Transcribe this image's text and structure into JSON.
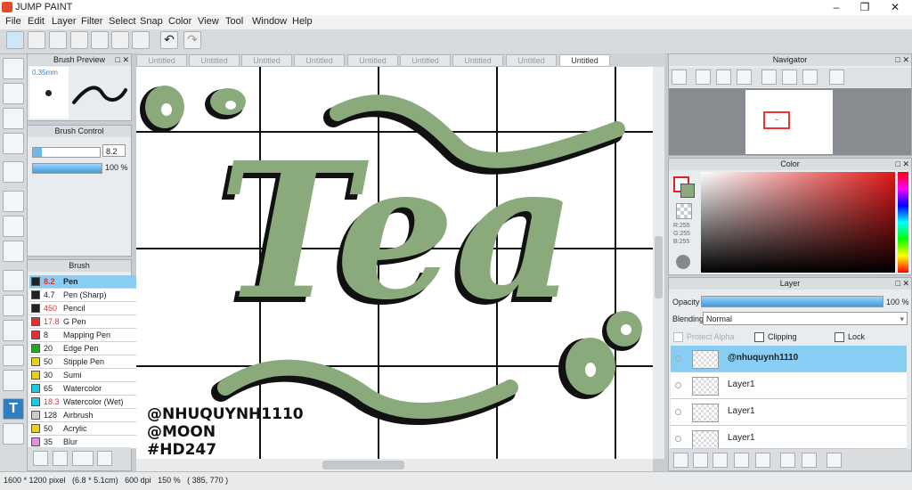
{
  "window": {
    "title": "JUMP PAINT"
  },
  "menu": [
    "File",
    "Edit",
    "Layer",
    "Filter",
    "Select",
    "Snap",
    "Color",
    "View",
    "Tool",
    "Window",
    "Help"
  ],
  "tabs": [
    "Untitled",
    "Untitled",
    "Untitled",
    "Untitled",
    "Untitled",
    "Untitled",
    "Untitled",
    "Untitled",
    "Untitled"
  ],
  "brush_preview": {
    "title": "Brush Preview",
    "size": "0.35mm"
  },
  "brush_control": {
    "title": "Brush Control",
    "size_value": "8.2",
    "opacity_value": "100 %"
  },
  "brush": {
    "title": "Brush",
    "items": [
      {
        "size": "8.2",
        "name": "Pen",
        "color": "#222222",
        "size_color": "#d33"
      },
      {
        "size": "4.7",
        "name": "Pen (Sharp)",
        "color": "#222222",
        "size_color": "#222"
      },
      {
        "size": "450",
        "name": "Pencil",
        "color": "#222222",
        "size_color": "#d33"
      },
      {
        "size": "17.8",
        "name": "G Pen",
        "color": "#e03030",
        "size_color": "#d33"
      },
      {
        "size": "8",
        "name": "Mapping Pen",
        "color": "#e03030",
        "size_color": "#222"
      },
      {
        "size": "20",
        "name": "Edge Pen",
        "color": "#22aa22",
        "size_color": "#222"
      },
      {
        "size": "50",
        "name": "Stipple Pen",
        "color": "#e8d020",
        "size_color": "#222"
      },
      {
        "size": "30",
        "name": "Sumi",
        "color": "#e8d020",
        "size_color": "#222"
      },
      {
        "size": "65",
        "name": "Watercolor",
        "color": "#1ec8e0",
        "size_color": "#222"
      },
      {
        "size": "18.3",
        "name": "Watercolor (Wet)",
        "color": "#1ec8e0",
        "size_color": "#d33"
      },
      {
        "size": "128",
        "name": "Airbrush",
        "color": "#cccccc",
        "size_color": "#222"
      },
      {
        "size": "50",
        "name": "Acrylic",
        "color": "#e8d020",
        "size_color": "#222"
      },
      {
        "size": "35",
        "name": "Blur",
        "color": "#e090e0",
        "size_color": "#222"
      }
    ]
  },
  "navigator": {
    "title": "Navigator"
  },
  "color": {
    "title": "Color",
    "r": "R:255",
    "g": "G:255",
    "b": "B:255"
  },
  "layer": {
    "title": "Layer",
    "opacity_label": "Opacity",
    "opacity_value": "100 %",
    "blending_label": "Blending",
    "blending_value": "Normal",
    "protect_alpha": "Protect Alpha",
    "clipping": "Clipping",
    "lock": "Lock",
    "items": [
      "@nhuquynh1110",
      "Layer1",
      "Layer1",
      "Layer1"
    ]
  },
  "canvas": {
    "word": "Tea",
    "signature_lines": [
      "@NHUQUYNH1110",
      "@MOON",
      "#HD247"
    ],
    "ink_color": "#8aaa7c"
  },
  "status": {
    "text": "1600 * 1200 pixel   (6.8 * 5.1cm)   600 dpi   150 %   ( 385, 770 )"
  }
}
